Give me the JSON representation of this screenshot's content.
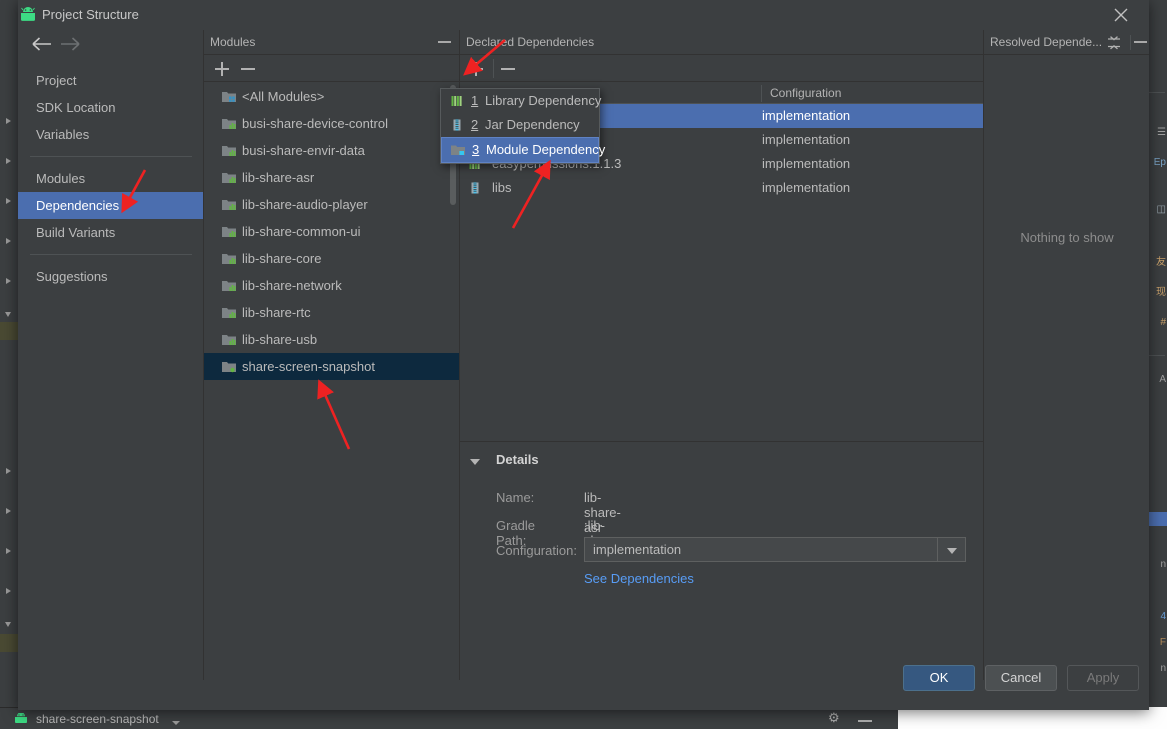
{
  "window": {
    "title": "Project Structure",
    "app_icon": "android-icon",
    "close_icon": "close-icon"
  },
  "nav": {
    "back_icon": "arrow-left-icon",
    "forward_icon": "arrow-right-icon"
  },
  "sidebar": {
    "items": [
      {
        "label": "Project",
        "selected": false
      },
      {
        "label": "SDK Location",
        "selected": false
      },
      {
        "label": "Variables",
        "selected": false
      },
      {
        "label": "Modules",
        "selected": false
      },
      {
        "label": "Dependencies",
        "selected": true
      },
      {
        "label": "Build Variants",
        "selected": false
      },
      {
        "label": "Suggestions",
        "selected": false
      }
    ]
  },
  "modules_panel": {
    "title": "Modules",
    "minimize_icon": "minimize-icon",
    "add_icon": "plus-icon",
    "remove_icon": "minus-icon",
    "items": [
      {
        "label": "<All Modules>",
        "icon": "all-modules-icon",
        "selected": false
      },
      {
        "label": "busi-share-device-control",
        "icon": "module-icon",
        "selected": false
      },
      {
        "label": "busi-share-envir-data",
        "icon": "module-icon",
        "selected": false
      },
      {
        "label": "lib-share-asr",
        "icon": "module-icon",
        "selected": false
      },
      {
        "label": "lib-share-audio-player",
        "icon": "module-icon",
        "selected": false
      },
      {
        "label": "lib-share-common-ui",
        "icon": "module-icon",
        "selected": false
      },
      {
        "label": "lib-share-core",
        "icon": "module-icon",
        "selected": false
      },
      {
        "label": "lib-share-network",
        "icon": "module-icon",
        "selected": false
      },
      {
        "label": "lib-share-rtc",
        "icon": "module-icon",
        "selected": false
      },
      {
        "label": "lib-share-usb",
        "icon": "module-icon",
        "selected": false
      },
      {
        "label": "share-screen-snapshot",
        "icon": "app-module-icon",
        "selected": true
      }
    ]
  },
  "declared_dependencies": {
    "title": "Declared Dependencies",
    "add_icon": "plus-icon",
    "remove_icon": "minus-icon",
    "columns": [
      "",
      "Configuration"
    ],
    "rows": [
      {
        "name": "",
        "icon": "module-dep-icon",
        "configuration": "implementation",
        "selected": true
      },
      {
        "name": "",
        "icon": "module-dep-icon",
        "configuration": "implementation",
        "selected": false
      },
      {
        "name": "easypermissions:1.1.3",
        "icon": "library-icon",
        "configuration": "implementation",
        "selected": false
      },
      {
        "name": "libs",
        "icon": "jar-icon",
        "configuration": "implementation",
        "selected": false
      }
    ]
  },
  "popup_menu": {
    "items": [
      {
        "num": "1",
        "label": "Library Dependency",
        "icon": "library-icon",
        "highlighted": false
      },
      {
        "num": "2",
        "label": "Jar Dependency",
        "icon": "jar-icon",
        "highlighted": false
      },
      {
        "num": "3",
        "label": "Module Dependency",
        "icon": "module-dep-icon",
        "highlighted": true
      }
    ]
  },
  "details": {
    "title": "Details",
    "collapse_icon": "triangle-down-icon",
    "name_label": "Name:",
    "name_value": "lib-share-asr",
    "gradle_path_label": "Gradle Path:",
    "gradle_path_value": ":lib-share-asr",
    "configuration_label": "Configuration:",
    "configuration_value": "implementation",
    "dropdown_icon": "chevron-down-icon",
    "see_dependencies_link": "See Dependencies"
  },
  "resolved_panel": {
    "title": "Resolved Depende...",
    "collapse_all_icon": "collapse-all-icon",
    "minimize_icon": "minimize-icon",
    "empty_text": "Nothing to show"
  },
  "buttons": {
    "ok": "OK",
    "cancel": "Cancel",
    "apply": "Apply"
  },
  "status_bar": {
    "module": "share-screen-snapshot",
    "dropdown_icon": "chevron-down-icon",
    "gear_icon": "gear-icon"
  },
  "colors": {
    "accent_blue": "#4b6eaf",
    "panel_bg": "#3c3f41",
    "selected_dark": "#0d293e",
    "link_blue": "#589df6",
    "annotation_red": "#ee2222"
  }
}
